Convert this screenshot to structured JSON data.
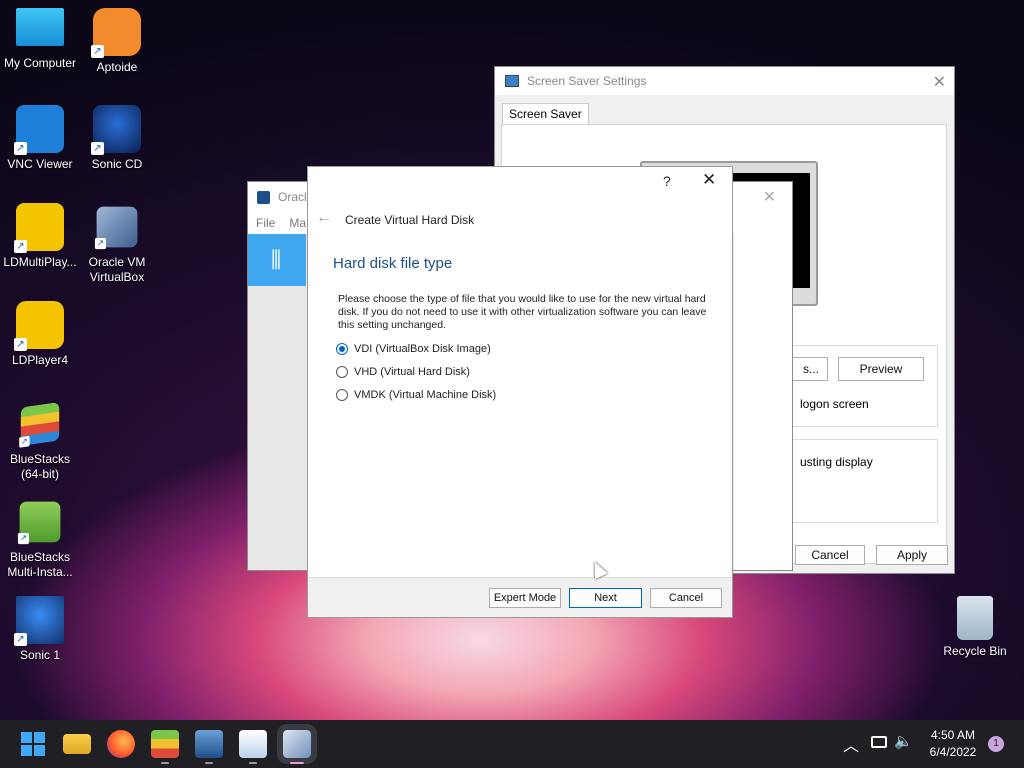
{
  "desktop": {
    "icons": [
      {
        "label": "My Computer"
      },
      {
        "label": "Aptoide"
      },
      {
        "label": "VNC Viewer"
      },
      {
        "label": "Sonic CD"
      },
      {
        "label": "LDMultiPlay..."
      },
      {
        "label": "Oracle VM VirtualBox"
      },
      {
        "label": "LDPlayer4"
      },
      {
        "label": "BlueStacks (64-bit)"
      },
      {
        "label": "BlueStacks Multi-Insta..."
      },
      {
        "label": "Sonic 1"
      },
      {
        "label": "Recycle Bin"
      }
    ]
  },
  "screensaver": {
    "title": "Screen Saver Settings",
    "tab": "Screen Saver",
    "settings_label": "s...",
    "preview_label": "Preview",
    "logon_text": "logon screen",
    "display_text": "usting display",
    "cancel_label": "Cancel",
    "apply_label": "Apply"
  },
  "virtualbox": {
    "title": "Oracle",
    "menu_file": "File",
    "menu_machine": "Ma"
  },
  "dialog": {
    "help": "?",
    "title": "Create Virtual Hard Disk",
    "heading": "Hard disk file type",
    "description": "Please choose the type of file that you would like to use for the new virtual hard disk. If you do not need to use it with other virtualization software you can leave this setting unchanged.",
    "options": [
      {
        "label": "VDI (VirtualBox Disk Image)",
        "checked": true
      },
      {
        "label": "VHD (Virtual Hard Disk)",
        "checked": false
      },
      {
        "label": "VMDK (Virtual Machine Disk)",
        "checked": false
      }
    ],
    "expert_label": "Expert Mode",
    "next_label": "Next",
    "cancel_label": "Cancel"
  },
  "taskbar": {
    "apps": [
      "start-icon",
      "file-explorer-icon",
      "firefox-icon",
      "bluestacks-icon",
      "virtualbox-manager-icon",
      "task-manager-icon",
      "virtualbox-icon"
    ],
    "time": "4:50 AM",
    "date": "6/4/2022",
    "notification_count": "1"
  }
}
